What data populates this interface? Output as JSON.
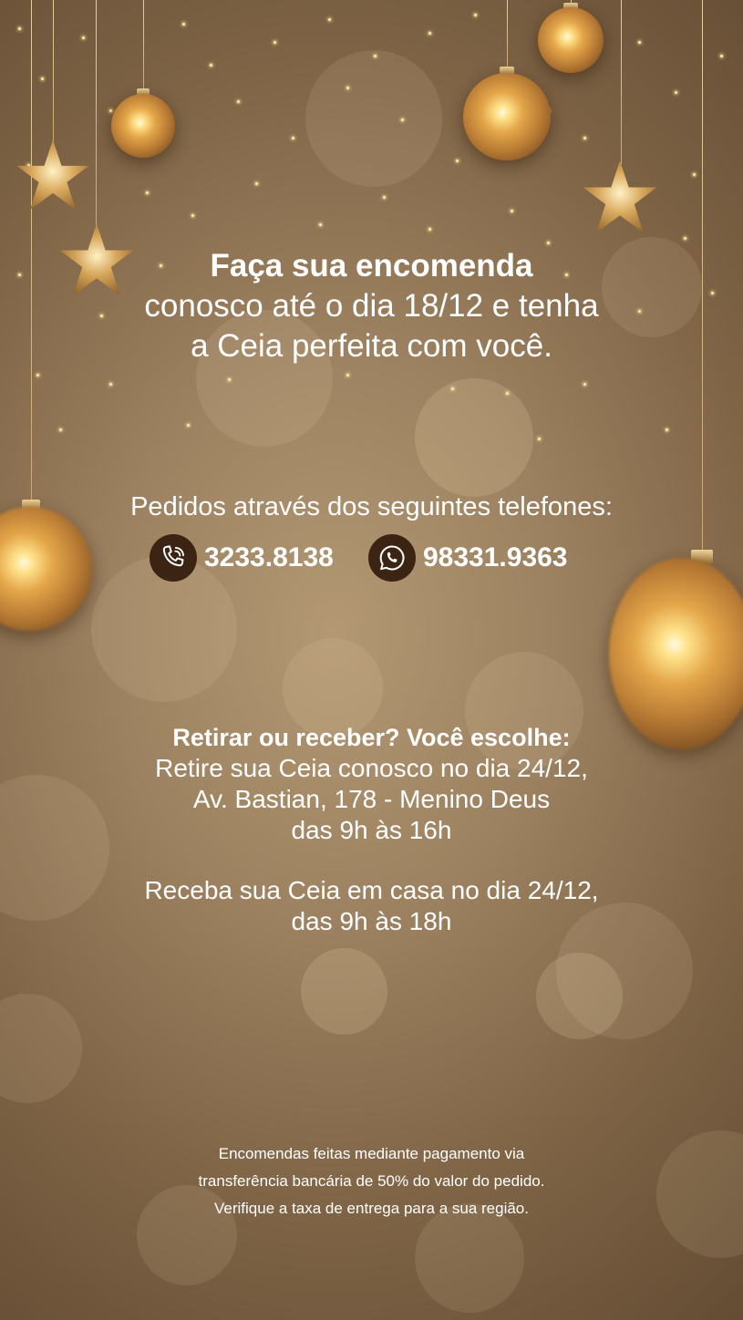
{
  "headline": {
    "line1": "Faça sua encomenda",
    "line2": "conosco até o dia 18/12 e tenha",
    "line3": "a Ceia perfeita com você."
  },
  "phones": {
    "title": "Pedidos através dos seguintes telefones:",
    "landline": {
      "icon": "phone-icon",
      "number": "3233.8138"
    },
    "whatsapp": {
      "icon": "whatsapp-icon",
      "number": "98331.9363"
    }
  },
  "pickup": {
    "title": "Retirar ou receber? Você escolhe:",
    "line1": "Retire sua Ceia conosco no dia 24/12,",
    "line2": "Av. Bastian, 178 -  Menino Deus",
    "line3": "das 9h às 16h",
    "delivery_line1": "Receba sua Ceia em casa no dia 24/12,",
    "delivery_line2": "das 9h às 18h"
  },
  "notes": {
    "line1": "Encomendas feitas mediante pagamento via",
    "line2": "transferência bancária de 50% do valor do pedido.",
    "line3": "Verifique a taxa de entrega para a sua região."
  },
  "colors": {
    "background": "#9c8160",
    "gold": "#e4a649",
    "icon_badge": "#3c2414",
    "text": "#ffffff"
  }
}
